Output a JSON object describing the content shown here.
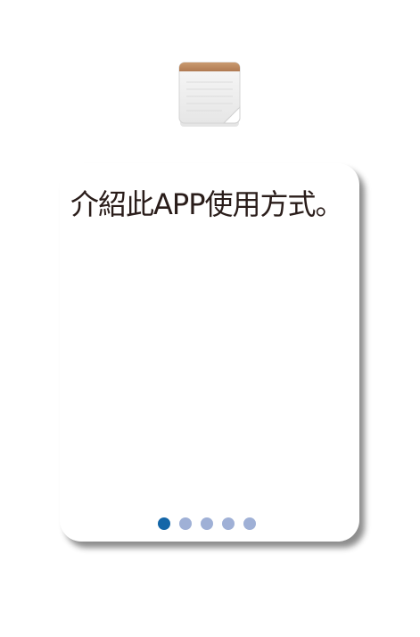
{
  "app": {
    "icon": "notepad-icon"
  },
  "intro": {
    "text": "介紹此APP使用方式。"
  },
  "pager": {
    "count": 5,
    "active_index": 0,
    "colors": {
      "active": "#1466a8",
      "inactive": "#9fb0d6"
    }
  }
}
